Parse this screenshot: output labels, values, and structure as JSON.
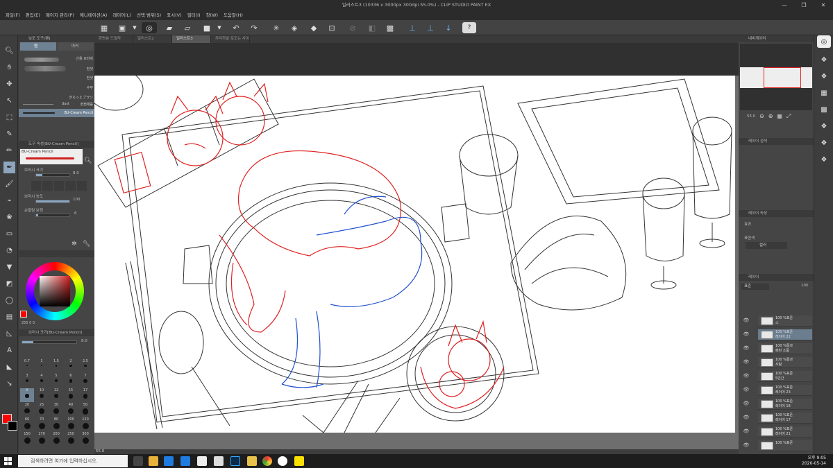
{
  "window": {
    "title": "일러스트3 (10336 x 3000px 300dpi 55.0%)  - CLIP STUDIO PAINT EX",
    "controls": [
      "—",
      "❐",
      "✕"
    ]
  },
  "menu": [
    "파일(F)",
    "편집(E)",
    "페이지 관리(P)",
    "애니메이션(A)",
    "레이어(L)",
    "선택 범위(S)",
    "표시(V)",
    "필터(I)",
    "창(W)",
    "도움말(H)"
  ],
  "doc_tabs": [
    "화면분 드릴락",
    "일러스트2",
    "일러스트3",
    "자리하발 토도는 사이",
    ""
  ],
  "active_tab": 2,
  "left_panel": {
    "sub_tool_header": "보조 도구[펜]",
    "tab_pen": "펜",
    "tab_marker": "마커",
    "brushes": [
      "신용 브러쉬",
      "펀셋",
      "펀셋",
      "수부",
      "きらっとブラシ",
      "dust",
      "현쩐재를",
      "BU-Cream Pencil"
    ],
    "tool_prop_header": "도구 속성[BU-Cream Pencil]",
    "current_brush": "BU-Cream Pencil",
    "brush_size_label": "브러시 크기",
    "brush_size_value": "8.0",
    "brush_density_label": "브러시 농도",
    "brush_density_value": "100",
    "stabilization_label": "손떨림 보정",
    "stabilization_value": "6",
    "size_panel_header": "브러시 크기[BU-Cream Pencil]",
    "size_panel_value": "8.0",
    "sizes": [
      "0.7",
      "1",
      "1.5",
      "2",
      "2.5",
      "3",
      "4",
      "5",
      "6",
      "7",
      "8",
      "10",
      "12",
      "15",
      "17",
      "20",
      "25",
      "30",
      "40",
      "50",
      "60",
      "70",
      "80",
      "100",
      "120",
      "150",
      "170",
      "200",
      "250",
      "300"
    ],
    "color_readout": "255  0  0"
  },
  "right_panel": {
    "navigator_header": "내비게이터",
    "zoom": "55.0",
    "layer_search_header": "레이어 검색",
    "layer_prop_header": "레이어 속성",
    "effect_label": "효과",
    "display_color_label": "표현색",
    "display_color_value": "컬러",
    "layers_header": "레이어",
    "blend_mode": "표준",
    "opacity": "100",
    "layers": [
      {
        "name": "100 %표준",
        "sub": "스",
        "selected": false
      },
      {
        "name": "100 %표준",
        "sub": "레이어 22",
        "selected": true
      },
      {
        "name": "100 %통과",
        "sub": "패턴 소품",
        "selected": false
      },
      {
        "name": "100 %통과",
        "sub": "사람",
        "selected": false
      },
      {
        "name": "100 %표준",
        "sub": "S인간",
        "selected": false
      },
      {
        "name": "100 %표준",
        "sub": "레이어 23",
        "selected": false
      },
      {
        "name": "100 %표준",
        "sub": "레이어 18",
        "selected": false
      },
      {
        "name": "100 %표준",
        "sub": "레이어 17",
        "selected": false
      },
      {
        "name": "100 %표준",
        "sub": "레이어 21",
        "selected": false
      },
      {
        "name": "100 %표준",
        "sub": "",
        "selected": false
      }
    ]
  },
  "status": {
    "zoom": "55.0"
  },
  "taskbar": {
    "search_placeholder": "검색하려면 여기에 입력하십시오.",
    "time": "오후 9:05",
    "date": "2020-05-14"
  },
  "colors": {
    "main_color": "#ff0000",
    "sub_color": "#000000",
    "sketch_red": "#e02020",
    "sketch_blue": "#2050d0"
  }
}
